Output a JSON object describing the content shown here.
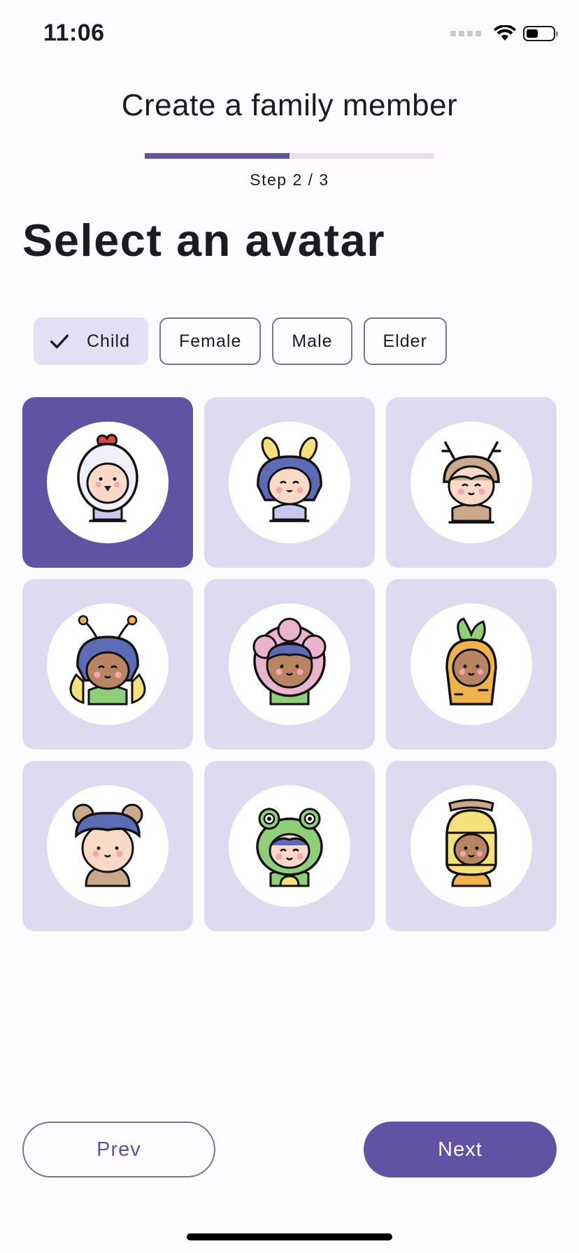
{
  "status_bar": {
    "time": "11:06",
    "icons": [
      "cellular-signal-icon",
      "wifi-icon",
      "battery-icon"
    ]
  },
  "header": {
    "title": "Create a family member"
  },
  "progress": {
    "current_step": 2,
    "total_steps": 3,
    "fraction": 0.5,
    "label": "Step 2 / 3"
  },
  "page_title": "Select an avatar",
  "filters": [
    {
      "label": "Child",
      "selected": true
    },
    {
      "label": "Female",
      "selected": false
    },
    {
      "label": "Male",
      "selected": false
    },
    {
      "label": "Elder",
      "selected": false
    }
  ],
  "avatars": [
    {
      "name": "chicken-costume-avatar",
      "selected": true
    },
    {
      "name": "bee-costume-avatar",
      "selected": false
    },
    {
      "name": "reindeer-costume-avatar",
      "selected": false
    },
    {
      "name": "butterfly-costume-avatar",
      "selected": false
    },
    {
      "name": "flower-costume-avatar",
      "selected": false
    },
    {
      "name": "carrot-costume-avatar",
      "selected": false
    },
    {
      "name": "bear-ears-avatar",
      "selected": false
    },
    {
      "name": "frog-costume-avatar",
      "selected": false
    },
    {
      "name": "honey-pot-costume-avatar",
      "selected": false
    }
  ],
  "buttons": {
    "prev": "Prev",
    "next": "Next"
  },
  "colors": {
    "primary": "#6252a4",
    "tile_background": "#e0daf0",
    "chip_selected": "#e6e0f7",
    "progress_track": "#e6e1ea",
    "page_background": "#fdfbfe"
  }
}
